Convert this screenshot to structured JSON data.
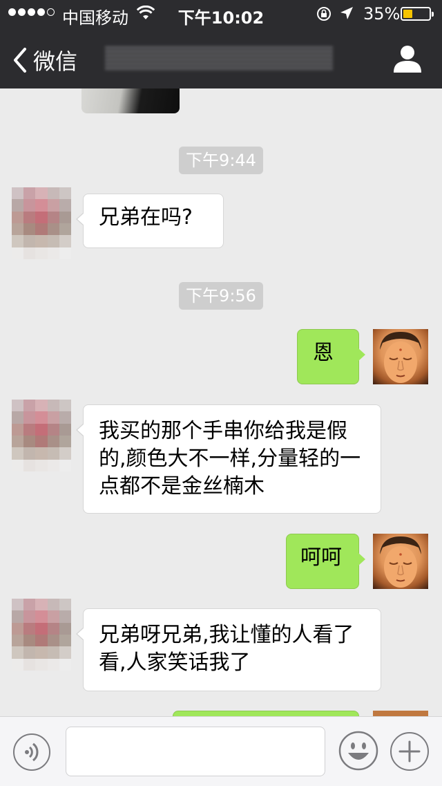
{
  "status_bar": {
    "carrier": "中国移动",
    "time": "下午10:02",
    "battery_percent": "35%",
    "battery_level": 0.35,
    "signal_bars_filled": 4,
    "signal_bars_total": 5
  },
  "nav": {
    "back_label": "微信",
    "title_obscured": true
  },
  "messages": [
    {
      "type": "timestamp",
      "text": "下午9:44"
    },
    {
      "type": "message",
      "side": "left",
      "text": "兄弟在吗?"
    },
    {
      "type": "timestamp",
      "text": "下午9:56"
    },
    {
      "type": "message",
      "side": "right",
      "text": "恩"
    },
    {
      "type": "message",
      "side": "left",
      "text": "我买的那个手串你给我是假的,颜色大不一样,分量轻的一点都不是金丝楠木"
    },
    {
      "type": "message",
      "side": "right",
      "text": "呵呵"
    },
    {
      "type": "message",
      "side": "left",
      "text": "兄弟呀兄弟,我让懂的人看了看,人家笑话我了"
    }
  ],
  "input": {
    "placeholder": "",
    "value": ""
  },
  "colors": {
    "nav_bg": "#2c2c2f",
    "chat_bg": "#ebebeb",
    "bubble_right": "#a0e75a",
    "bubble_left": "#ffffff",
    "timestamp_bg": "#cecece",
    "battery_fill": "#f5c400"
  },
  "icons": {
    "back": "chevron-left-icon",
    "profile": "person-icon",
    "voice": "voice-icon",
    "emoji": "emoji-icon",
    "plus": "plus-icon",
    "wifi": "wifi-icon",
    "lock": "orientation-lock-icon",
    "location": "location-arrow-icon"
  }
}
